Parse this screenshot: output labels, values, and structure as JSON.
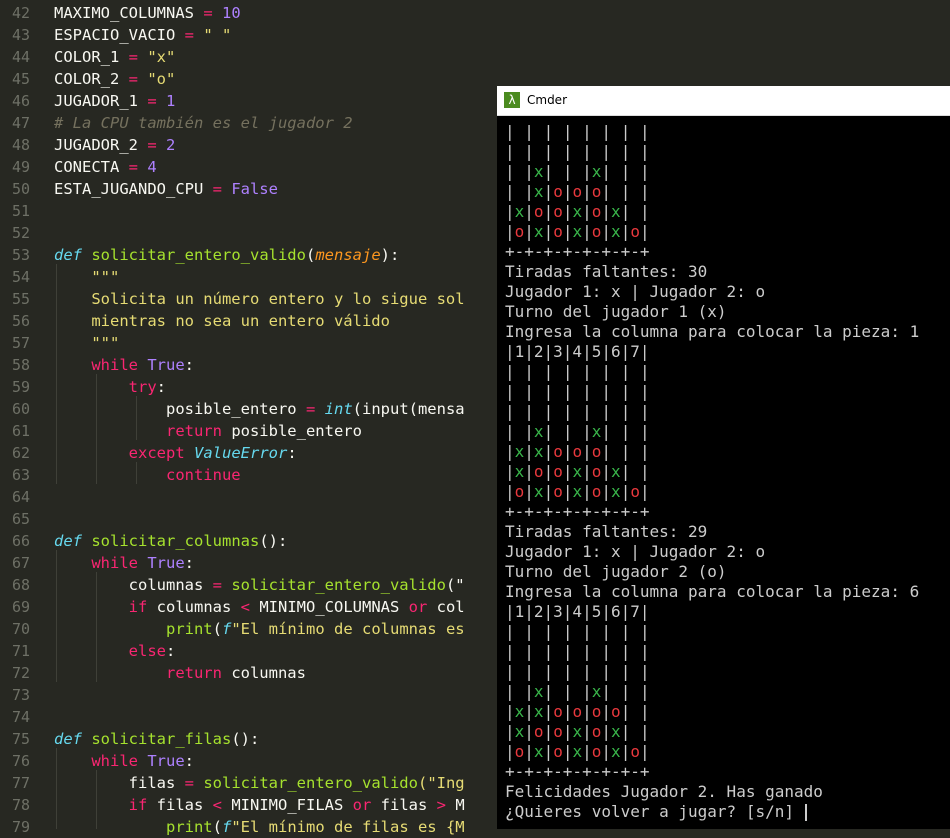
{
  "editor": {
    "lines": [
      {
        "n": "42",
        "tokens": [
          {
            "t": "MAXIMO_COLUMNAS",
            "c": "var"
          },
          {
            "t": " = ",
            "c": "op"
          },
          {
            "t": "10",
            "c": "num"
          }
        ]
      },
      {
        "n": "43",
        "tokens": [
          {
            "t": "ESPACIO_VACIO",
            "c": "var"
          },
          {
            "t": " = ",
            "c": "op"
          },
          {
            "t": "\" \"",
            "c": "str"
          }
        ]
      },
      {
        "n": "44",
        "tokens": [
          {
            "t": "COLOR_1",
            "c": "var"
          },
          {
            "t": " = ",
            "c": "op"
          },
          {
            "t": "\"x\"",
            "c": "str"
          }
        ]
      },
      {
        "n": "45",
        "tokens": [
          {
            "t": "COLOR_2",
            "c": "var"
          },
          {
            "t": " = ",
            "c": "op"
          },
          {
            "t": "\"o\"",
            "c": "str"
          }
        ]
      },
      {
        "n": "46",
        "tokens": [
          {
            "t": "JUGADOR_1",
            "c": "var"
          },
          {
            "t": " = ",
            "c": "op"
          },
          {
            "t": "1",
            "c": "num"
          }
        ]
      },
      {
        "n": "47",
        "tokens": [
          {
            "t": "# La CPU también es el jugador 2",
            "c": "cmt"
          }
        ]
      },
      {
        "n": "48",
        "tokens": [
          {
            "t": "JUGADOR_2",
            "c": "var"
          },
          {
            "t": " = ",
            "c": "op"
          },
          {
            "t": "2",
            "c": "num"
          }
        ]
      },
      {
        "n": "49",
        "tokens": [
          {
            "t": "CONECTA",
            "c": "var"
          },
          {
            "t": " = ",
            "c": "op"
          },
          {
            "t": "4",
            "c": "num"
          }
        ]
      },
      {
        "n": "50",
        "tokens": [
          {
            "t": "ESTA_JUGANDO_CPU",
            "c": "var"
          },
          {
            "t": " = ",
            "c": "op"
          },
          {
            "t": "False",
            "c": "num"
          }
        ]
      },
      {
        "n": "51",
        "tokens": []
      },
      {
        "n": "52",
        "tokens": []
      },
      {
        "n": "53",
        "tokens": [
          {
            "t": "def",
            "c": "def"
          },
          {
            "t": " ",
            "c": "plain"
          },
          {
            "t": "solicitar_entero_valido",
            "c": "fn"
          },
          {
            "t": "(",
            "c": "plain"
          },
          {
            "t": "mensaje",
            "c": "prm"
          },
          {
            "t": "):",
            "c": "plain"
          }
        ]
      },
      {
        "n": "54",
        "tokens": [
          {
            "t": "    \"\"\"",
            "c": "str"
          }
        ]
      },
      {
        "n": "55",
        "tokens": [
          {
            "t": "    Solicita un número entero y lo sigue sol",
            "c": "str"
          }
        ]
      },
      {
        "n": "56",
        "tokens": [
          {
            "t": "    mientras no sea un entero válido",
            "c": "str"
          }
        ]
      },
      {
        "n": "57",
        "tokens": [
          {
            "t": "    \"\"\"",
            "c": "str"
          }
        ]
      },
      {
        "n": "58",
        "tokens": [
          {
            "t": "    ",
            "c": "plain"
          },
          {
            "t": "while",
            "c": "kw"
          },
          {
            "t": " ",
            "c": "plain"
          },
          {
            "t": "True",
            "c": "num"
          },
          {
            "t": ":",
            "c": "plain"
          }
        ]
      },
      {
        "n": "59",
        "tokens": [
          {
            "t": "        ",
            "c": "plain"
          },
          {
            "t": "try",
            "c": "kw"
          },
          {
            "t": ":",
            "c": "plain"
          }
        ]
      },
      {
        "n": "60",
        "tokens": [
          {
            "t": "            posible_entero ",
            "c": "plain"
          },
          {
            "t": "=",
            "c": "op"
          },
          {
            "t": " ",
            "c": "plain"
          },
          {
            "t": "int",
            "c": "bi"
          },
          {
            "t": "(input(mensa",
            "c": "plain"
          }
        ]
      },
      {
        "n": "61",
        "tokens": [
          {
            "t": "            ",
            "c": "plain"
          },
          {
            "t": "return",
            "c": "kw"
          },
          {
            "t": " posible_entero",
            "c": "plain"
          }
        ]
      },
      {
        "n": "62",
        "tokens": [
          {
            "t": "        ",
            "c": "plain"
          },
          {
            "t": "except",
            "c": "kw"
          },
          {
            "t": " ",
            "c": "plain"
          },
          {
            "t": "ValueError",
            "c": "bi"
          },
          {
            "t": ":",
            "c": "plain"
          }
        ]
      },
      {
        "n": "63",
        "tokens": [
          {
            "t": "            ",
            "c": "plain"
          },
          {
            "t": "continue",
            "c": "kw"
          }
        ]
      },
      {
        "n": "64",
        "tokens": []
      },
      {
        "n": "65",
        "tokens": []
      },
      {
        "n": "66",
        "tokens": [
          {
            "t": "def",
            "c": "def"
          },
          {
            "t": " ",
            "c": "plain"
          },
          {
            "t": "solicitar_columnas",
            "c": "fn"
          },
          {
            "t": "():",
            "c": "plain"
          }
        ]
      },
      {
        "n": "67",
        "tokens": [
          {
            "t": "    ",
            "c": "plain"
          },
          {
            "t": "while",
            "c": "kw"
          },
          {
            "t": " ",
            "c": "plain"
          },
          {
            "t": "True",
            "c": "num"
          },
          {
            "t": ":",
            "c": "plain"
          }
        ]
      },
      {
        "n": "68",
        "tokens": [
          {
            "t": "        columnas ",
            "c": "plain"
          },
          {
            "t": "=",
            "c": "op"
          },
          {
            "t": " ",
            "c": "plain"
          },
          {
            "t": "solicitar_entero_valido",
            "c": "fn"
          },
          {
            "t": "(\"",
            "c": "plain"
          }
        ]
      },
      {
        "n": "69",
        "tokens": [
          {
            "t": "        ",
            "c": "plain"
          },
          {
            "t": "if",
            "c": "kw"
          },
          {
            "t": " columnas ",
            "c": "plain"
          },
          {
            "t": "<",
            "c": "op"
          },
          {
            "t": " MINIMO_COLUMNAS ",
            "c": "plain"
          },
          {
            "t": "or",
            "c": "kw"
          },
          {
            "t": " col",
            "c": "plain"
          }
        ]
      },
      {
        "n": "70",
        "tokens": [
          {
            "t": "            ",
            "c": "plain"
          },
          {
            "t": "print",
            "c": "fn"
          },
          {
            "t": "(",
            "c": "plain"
          },
          {
            "t": "f",
            "c": "bi"
          },
          {
            "t": "\"El mínimo de columnas es",
            "c": "str"
          }
        ]
      },
      {
        "n": "71",
        "tokens": [
          {
            "t": "        ",
            "c": "plain"
          },
          {
            "t": "else",
            "c": "kw"
          },
          {
            "t": ":",
            "c": "plain"
          }
        ]
      },
      {
        "n": "72",
        "tokens": [
          {
            "t": "            ",
            "c": "plain"
          },
          {
            "t": "return",
            "c": "kw"
          },
          {
            "t": " columnas",
            "c": "plain"
          }
        ]
      },
      {
        "n": "73",
        "tokens": []
      },
      {
        "n": "74",
        "tokens": []
      },
      {
        "n": "75",
        "tokens": [
          {
            "t": "def",
            "c": "def"
          },
          {
            "t": " ",
            "c": "plain"
          },
          {
            "t": "solicitar_filas",
            "c": "fn"
          },
          {
            "t": "():",
            "c": "plain"
          }
        ]
      },
      {
        "n": "76",
        "tokens": [
          {
            "t": "    ",
            "c": "plain"
          },
          {
            "t": "while",
            "c": "kw"
          },
          {
            "t": " ",
            "c": "plain"
          },
          {
            "t": "True",
            "c": "num"
          },
          {
            "t": ":",
            "c": "plain"
          }
        ]
      },
      {
        "n": "77",
        "tokens": [
          {
            "t": "        filas ",
            "c": "plain"
          },
          {
            "t": "=",
            "c": "op"
          },
          {
            "t": " ",
            "c": "plain"
          },
          {
            "t": "solicitar_entero_valido",
            "c": "fn"
          },
          {
            "t": "(\"Ing",
            "c": "str"
          }
        ]
      },
      {
        "n": "78",
        "tokens": [
          {
            "t": "        ",
            "c": "plain"
          },
          {
            "t": "if",
            "c": "kw"
          },
          {
            "t": " filas ",
            "c": "plain"
          },
          {
            "t": "<",
            "c": "op"
          },
          {
            "t": " MINIMO_FILAS ",
            "c": "plain"
          },
          {
            "t": "or",
            "c": "kw"
          },
          {
            "t": " filas ",
            "c": "plain"
          },
          {
            "t": ">",
            "c": "op"
          },
          {
            "t": " M",
            "c": "plain"
          }
        ]
      },
      {
        "n": "79",
        "tokens": [
          {
            "t": "            ",
            "c": "plain"
          },
          {
            "t": "print",
            "c": "fn"
          },
          {
            "t": "(",
            "c": "plain"
          },
          {
            "t": "f",
            "c": "bi"
          },
          {
            "t": "\"El mínimo de filas es {M",
            "c": "str"
          }
        ]
      }
    ]
  },
  "cmder": {
    "title": "Cmder",
    "icon_glyph": "λ",
    "colors": {
      "x": "#39b54a",
      "o": "#e8383d",
      "text": "#cccccc",
      "background": "#000000"
    },
    "lines": [
      "| | | | | | | |",
      "| | | | | | | |",
      "| |x| | |x| | |",
      "| |x|o|o|o| | |",
      "|x|o|o|x|o|x| |",
      "|o|x|o|x|o|x|o|",
      "+-+-+-+-+-+-+-+",
      "Tiradas faltantes: 30",
      "Jugador 1: x | Jugador 2: o",
      "Turno del jugador 1 (x)",
      "Ingresa la columna para colocar la pieza: 1",
      "|1|2|3|4|5|6|7|",
      "| | | | | | | |",
      "| | | | | | | |",
      "| | | | | | | |",
      "| |x| | |x| | |",
      "|x|x|o|o|o| | |",
      "|x|o|o|x|o|x| |",
      "|o|x|o|x|o|x|o|",
      "+-+-+-+-+-+-+-+",
      "Tiradas faltantes: 29",
      "Jugador 1: x | Jugador 2: o",
      "Turno del jugador 2 (o)",
      "Ingresa la columna para colocar la pieza: 6",
      "|1|2|3|4|5|6|7|",
      "| | | | | | | |",
      "| | | | | | | |",
      "| | | | | | | |",
      "| |x| | |x| | |",
      "|x|x|o|o|o|o| |",
      "|x|o|o|x|o|x| |",
      "|o|x|o|x|o|x|o|",
      "+-+-+-+-+-+-+-+",
      "Felicidades Jugador 2. Has ganado",
      "¿Quieres volver a jugar? [s/n] "
    ]
  }
}
